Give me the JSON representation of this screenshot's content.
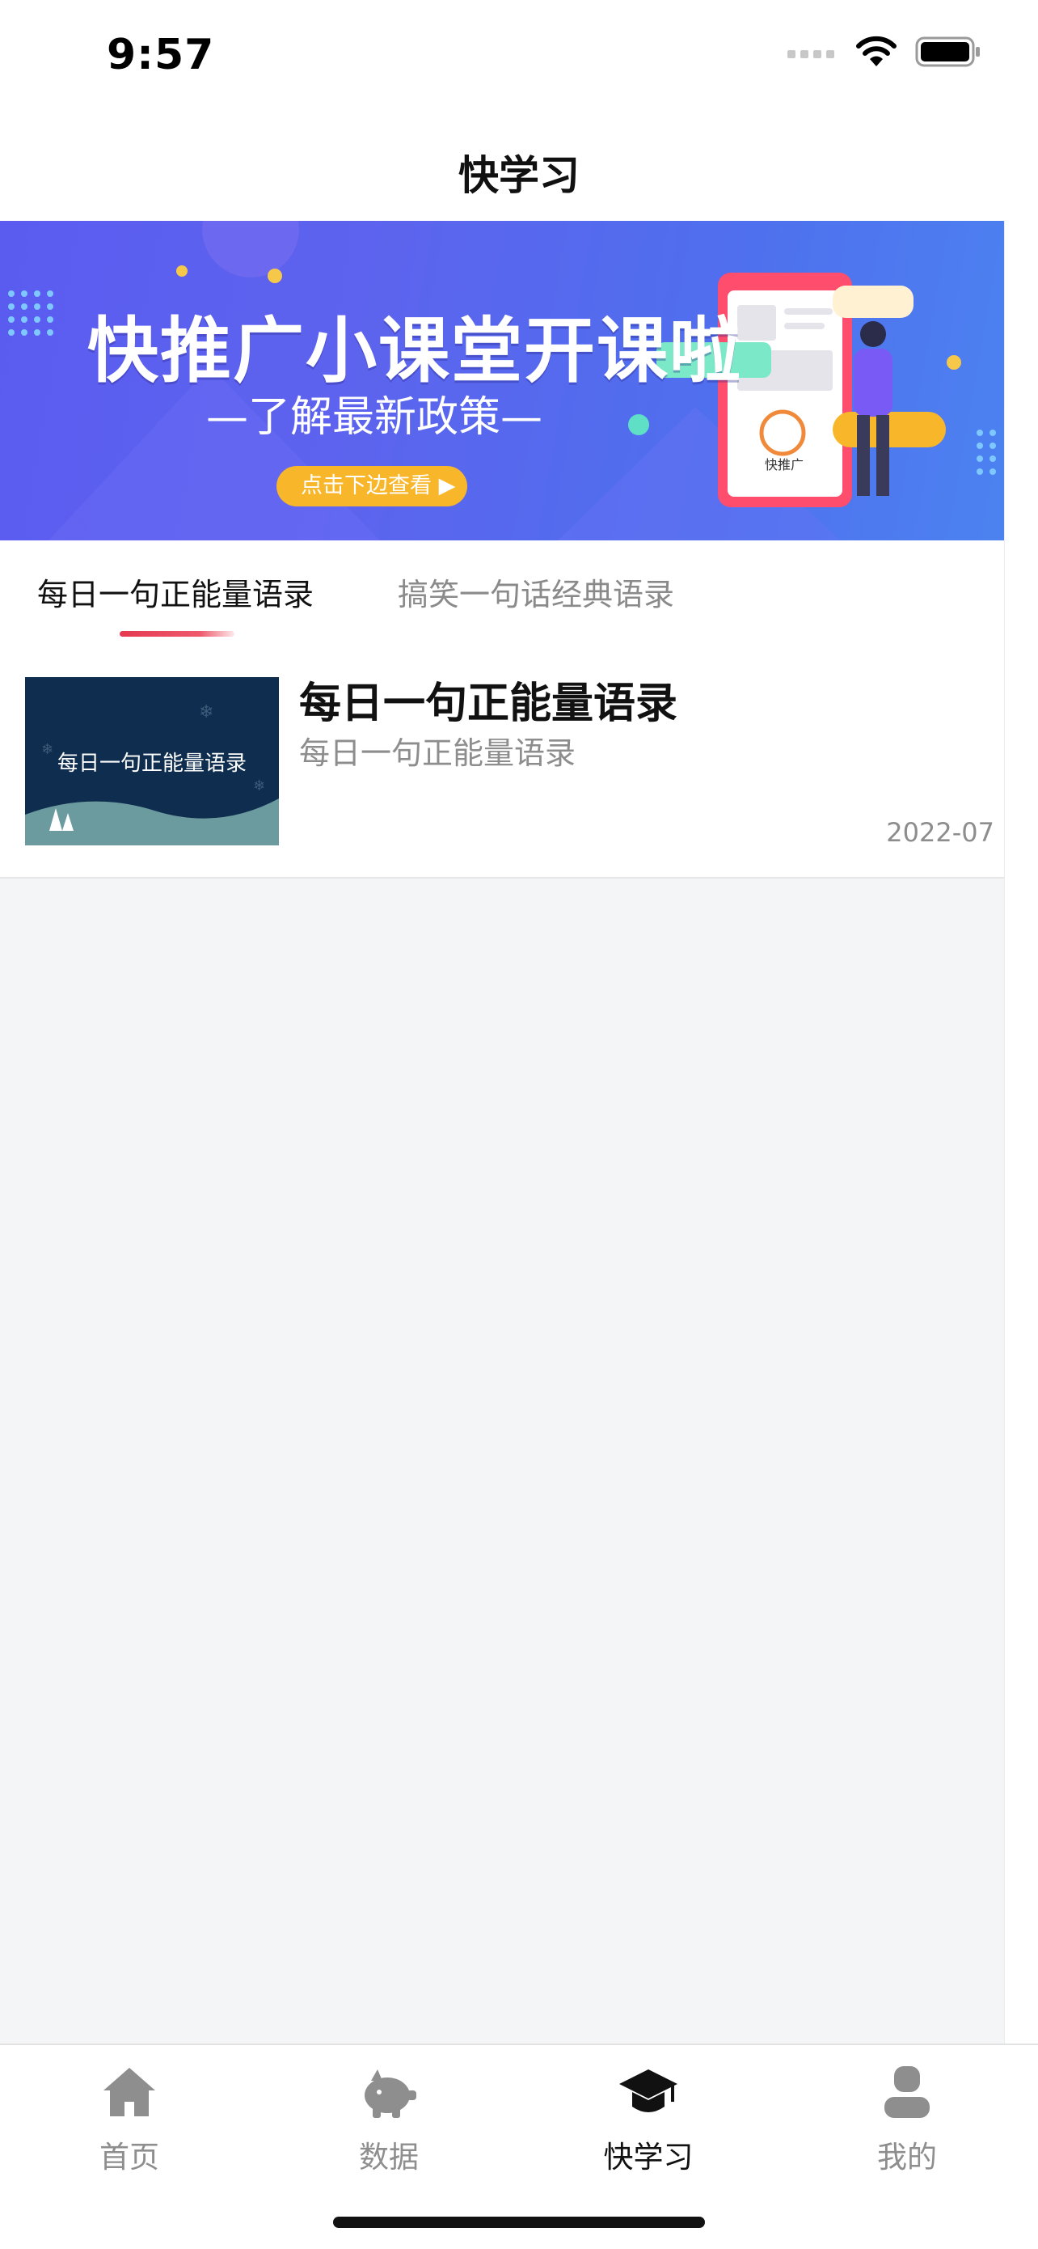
{
  "status_bar": {
    "time": "9:57"
  },
  "nav": {
    "title": "快学习"
  },
  "banner": {
    "title": "快推广小课堂开课啦",
    "subtitle": "—了解最新政策—",
    "button": "点击下边查看 ▶",
    "logo_text": "快推广"
  },
  "tabs": [
    {
      "label": "每日一句正能量语录",
      "active": true
    },
    {
      "label": "搞笑一句话经典语录",
      "active": false
    }
  ],
  "articles": [
    {
      "thumbnail_text": "每日一句正能量语录",
      "title": "每日一句正能量语录",
      "subtitle": "每日一句正能量语录",
      "date": "2022-07"
    }
  ],
  "tab_bar": [
    {
      "label": "首页",
      "icon": "home-icon",
      "active": false
    },
    {
      "label": "数据",
      "icon": "piggy-bank-icon",
      "active": false
    },
    {
      "label": "快学习",
      "icon": "graduation-cap-icon",
      "active": true
    },
    {
      "label": "我的",
      "icon": "user-icon",
      "active": false
    }
  ],
  "colors": {
    "accent_red": "#e53950",
    "banner_yellow": "#f8b62b",
    "banner_blue": "#5a5cf0"
  }
}
